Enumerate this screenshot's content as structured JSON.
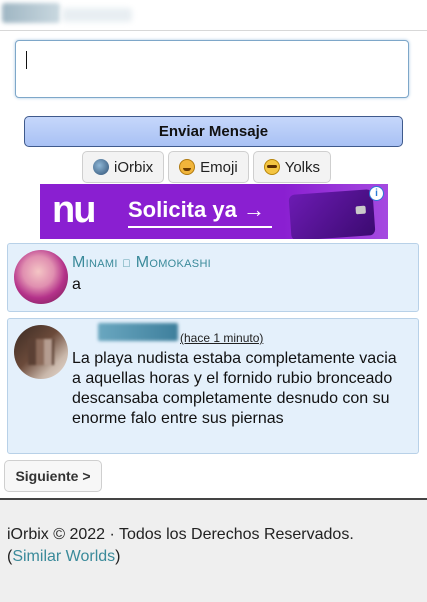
{
  "message_box": {
    "placeholder": ""
  },
  "send_button": {
    "label": "Enviar Mensaje"
  },
  "tools": [
    {
      "label": "iOrbix",
      "icon": "orbix-icon"
    },
    {
      "label": "Emoji",
      "icon": "emoji-face-icon"
    },
    {
      "label": "Yolks",
      "icon": "yolks-face-icon"
    }
  ],
  "ad": {
    "brand": "nu",
    "cta": "Solicita ya →",
    "info": "i"
  },
  "posts": [
    {
      "username": "Minami ღ Momokashi",
      "time": "",
      "text": "a"
    },
    {
      "username": "",
      "time": "(hace 1 minuto)",
      "text": "La playa nudista estaba completamente vacia a aquellas horas y el fornido rubio bronceado descansaba completamente desnudo con su enorme falo entre sus piernas"
    }
  ],
  "next_button": {
    "label": "Siguiente >"
  },
  "footer": {
    "copyright": "iOrbix © 2022 · Todos los Derechos Reservados.",
    "open_paren": "(",
    "link": "Similar Worlds",
    "close_paren": ")"
  },
  "colors": {
    "accent": "#3a8a9a",
    "post_bg": "#e4f0fb",
    "ad_purple": "#8a1fd1",
    "send_button": "#b7cbf8"
  }
}
